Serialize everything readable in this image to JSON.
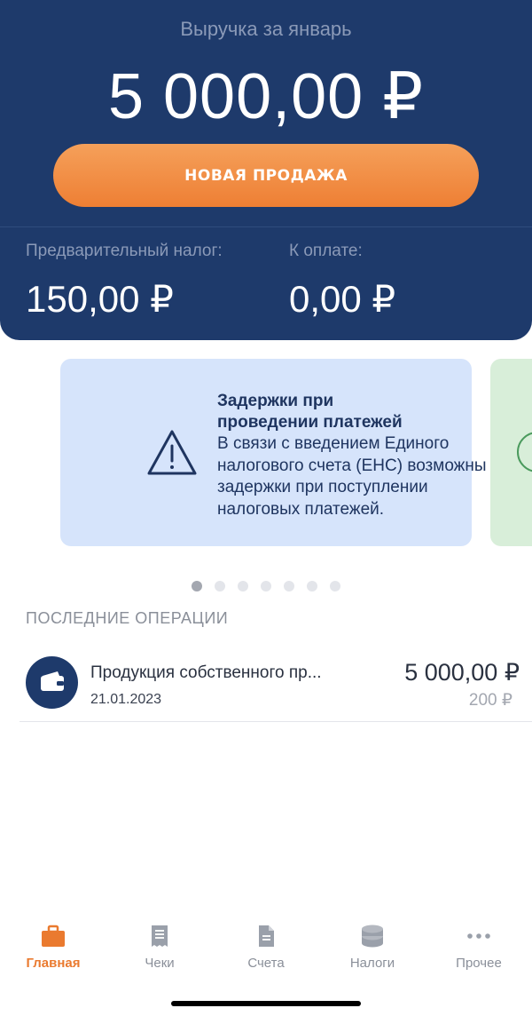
{
  "header": {
    "revenue_label": "Выручка за январь",
    "revenue_amount": "5 000,00 ₽",
    "new_sale_label": "НОВАЯ ПРОДАЖА",
    "pre_tax_label": "Предварительный налог:",
    "pre_tax_value": "150,00 ₽",
    "to_pay_label": "К оплате:",
    "to_pay_value": "0,00 ₽"
  },
  "banner": {
    "title_line1": "Задержки при",
    "title_line2": "проведении платежей",
    "text_line1": "В связи с введением Единого",
    "text_line2": "налогового счета (ЕНС) возможны",
    "text_line3": "задержки при поступлении",
    "text_line4": "налоговых платежей.",
    "icon": "warning-triangle-icon"
  },
  "pagination": {
    "total": 7,
    "active": 1
  },
  "recent": {
    "title": "ПОСЛЕДНИЕ ОПЕРАЦИИ",
    "items": [
      {
        "name": "Продукция собственного пр...",
        "date": "21.01.2023",
        "amount": "5 000,00 ₽",
        "sub_amount": "200 ₽",
        "icon": "wallet-icon"
      }
    ]
  },
  "tabbar": {
    "items": [
      {
        "label": "Главная",
        "icon": "briefcase-icon",
        "active": true
      },
      {
        "label": "Чеки",
        "icon": "receipt-icon",
        "active": false
      },
      {
        "label": "Счета",
        "icon": "document-icon",
        "active": false
      },
      {
        "label": "Налоги",
        "icon": "coins-icon",
        "active": false
      },
      {
        "label": "Прочее",
        "icon": "more-dots-icon",
        "active": false
      }
    ]
  },
  "colors": {
    "header_bg": "#1e3a6b",
    "accent": "#ee7f34",
    "banner_bg": "#d6e4fb",
    "banner_next_bg": "#d8eed9"
  }
}
